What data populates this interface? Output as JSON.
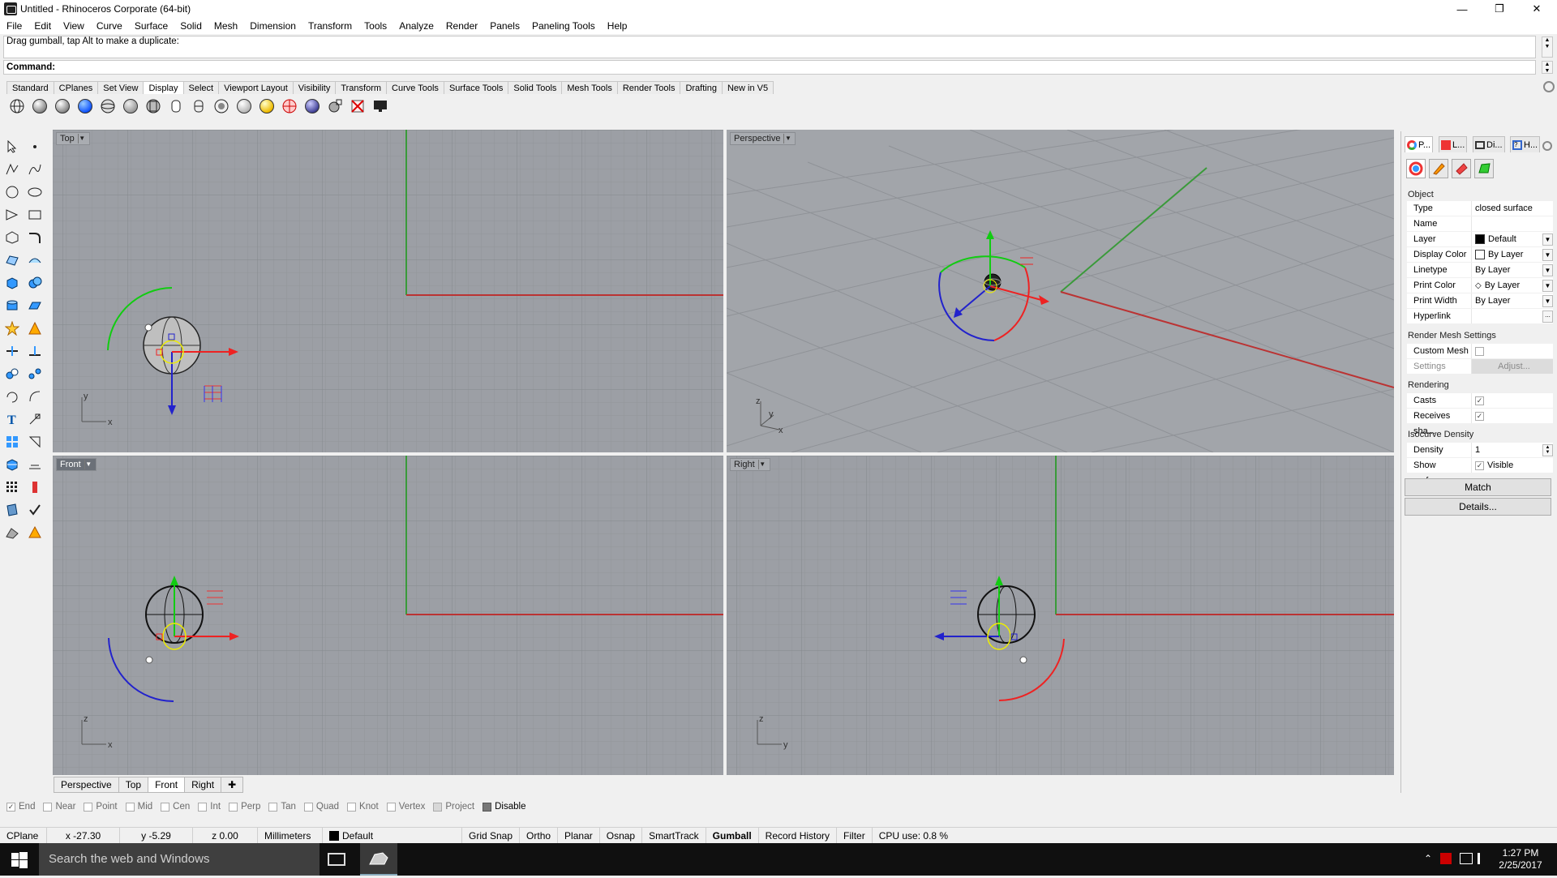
{
  "window": {
    "title": "Untitled - Rhinoceros Corporate (64-bit)"
  },
  "menu": [
    "File",
    "Edit",
    "View",
    "Curve",
    "Surface",
    "Solid",
    "Mesh",
    "Dimension",
    "Transform",
    "Tools",
    "Analyze",
    "Render",
    "Panels",
    "Paneling Tools",
    "Help"
  ],
  "command_history": "Drag gumball, tap Alt to make a duplicate:",
  "command_prompt": "Command:",
  "toolbar_tabs": [
    "Standard",
    "CPlanes",
    "Set View",
    "Display",
    "Select",
    "Viewport Layout",
    "Visibility",
    "Transform",
    "Curve Tools",
    "Surface Tools",
    "Solid Tools",
    "Mesh Tools",
    "Render Tools",
    "Drafting",
    "New in V5"
  ],
  "active_toolbar_tab": "Display",
  "display_icons": [
    "wireframe-icon",
    "shaded-icon",
    "rendered-icon",
    "ghosted-icon",
    "xray-icon",
    "technical-icon",
    "artistic-icon",
    "pen-icon",
    "mode1-icon",
    "mode2-icon",
    "mode3-icon",
    "sun-icon",
    "zebra-icon",
    "draft-angle-icon",
    "curvature-icon",
    "environment-icon",
    "turn-off-icon",
    "display-icon"
  ],
  "viewports": {
    "top": {
      "label": "Top",
      "axis_h": "x",
      "axis_v": "y"
    },
    "perspective": {
      "label": "Perspective",
      "axis_h": "x",
      "axis_v": "y",
      "axis_z": "z"
    },
    "front": {
      "label": "Front",
      "axis_h": "x",
      "axis_v": "z"
    },
    "right": {
      "label": "Right",
      "axis_h": "y",
      "axis_v": "z"
    }
  },
  "viewport_tabs": [
    "Perspective",
    "Top",
    "Front",
    "Right"
  ],
  "active_viewport_tab": "Front",
  "osnaps": [
    {
      "label": "End",
      "checked": true
    },
    {
      "label": "Near",
      "checked": false
    },
    {
      "label": "Point",
      "checked": false
    },
    {
      "label": "Mid",
      "checked": false
    },
    {
      "label": "Cen",
      "checked": false
    },
    {
      "label": "Int",
      "checked": false
    },
    {
      "label": "Perp",
      "checked": false
    },
    {
      "label": "Tan",
      "checked": false
    },
    {
      "label": "Quad",
      "checked": false
    },
    {
      "label": "Knot",
      "checked": false
    },
    {
      "label": "Vertex",
      "checked": false
    },
    {
      "label": "Project",
      "checked": false
    },
    {
      "label": "Disable",
      "checked": false
    }
  ],
  "status": {
    "cplane": "CPlane",
    "x": "x -27.30",
    "y": "y -5.29",
    "z": "z 0.00",
    "units": "Millimeters",
    "layer": "Default",
    "grid_snap": "Grid Snap",
    "ortho": "Ortho",
    "planar": "Planar",
    "osnap": "Osnap",
    "smarttrack": "SmartTrack",
    "gumball": "Gumball",
    "record_history": "Record History",
    "filter": "Filter",
    "cpu": "CPU use: 0.8 %"
  },
  "panel": {
    "tabs": [
      "P...",
      "L...",
      "Di...",
      "H..."
    ],
    "section_object": "Object",
    "props": [
      {
        "k": "Type",
        "v": "closed surface"
      },
      {
        "k": "Name",
        "v": ""
      },
      {
        "k": "Layer",
        "v": "Default"
      },
      {
        "k": "Display Color",
        "v": "By Layer"
      },
      {
        "k": "Linetype",
        "v": "By Layer"
      },
      {
        "k": "Print Color",
        "v": "By Layer"
      },
      {
        "k": "Print Width",
        "v": "By Layer"
      },
      {
        "k": "Hyperlink",
        "v": ""
      }
    ],
    "section_mesh": "Render Mesh Settings",
    "custom_mesh": "Custom Mesh",
    "settings": "Settings",
    "adjust": "Adjust...",
    "section_render": "Rendering",
    "casts_shadows": "Casts shadows",
    "receives_shadows": "Receives sha...",
    "section_iso": "Isocurve Density",
    "density_label": "Density",
    "density_value": "1",
    "show_surface": "Show surface...",
    "visible": "Visible",
    "match": "Match",
    "details": "Details..."
  },
  "taskbar": {
    "search": "Search the web and Windows",
    "time": "1:27 PM",
    "date": "2/25/2017"
  }
}
